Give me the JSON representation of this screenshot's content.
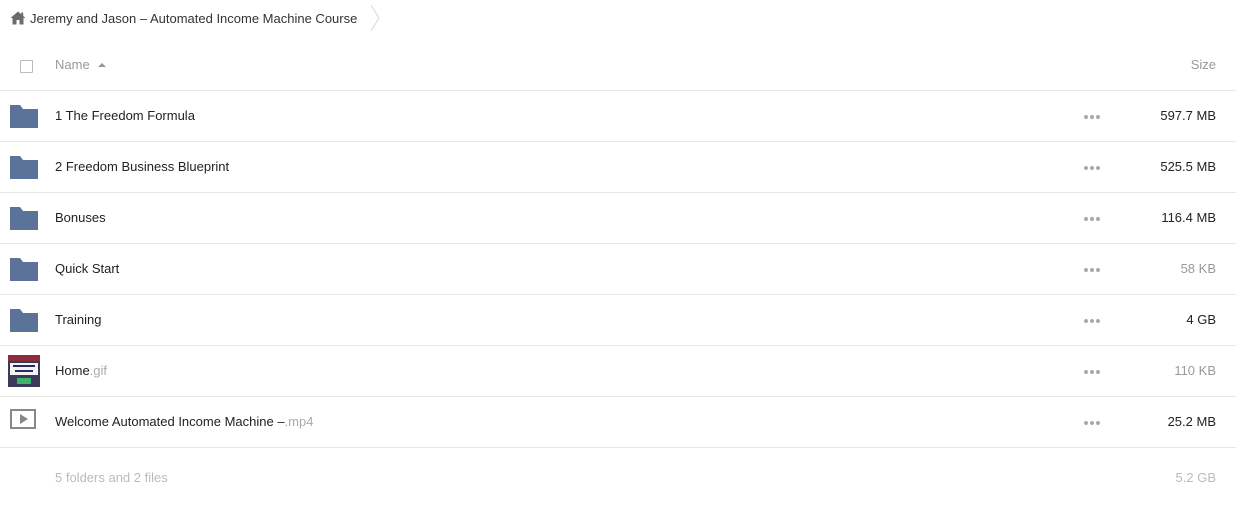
{
  "breadcrumb": {
    "home_icon": "home-icon",
    "title": "Jeremy and Jason – Automated Income Machine Course"
  },
  "header": {
    "name_label": "Name",
    "size_label": "Size",
    "sort_icon": "sort-ascending-icon"
  },
  "colors": {
    "folder": "#5b7399",
    "border": "#e8e8e8",
    "muted_text": "#999999"
  },
  "items": [
    {
      "type": "folder",
      "icon": "folder-icon",
      "name": "1 The Freedom Formula",
      "ext": "",
      "size": "597.7 MB",
      "size_dim": false
    },
    {
      "type": "folder",
      "icon": "folder-icon",
      "name": "2 Freedom Business Blueprint",
      "ext": "",
      "size": "525.5 MB",
      "size_dim": false
    },
    {
      "type": "folder",
      "icon": "folder-icon",
      "name": "Bonuses",
      "ext": "",
      "size": "116.4 MB",
      "size_dim": false
    },
    {
      "type": "folder",
      "icon": "folder-icon",
      "name": "Quick Start",
      "ext": "",
      "size": "58 KB",
      "size_dim": true
    },
    {
      "type": "folder",
      "icon": "folder-icon",
      "name": "Training",
      "ext": "",
      "size": "4 GB",
      "size_dim": false
    },
    {
      "type": "image",
      "icon": "image-thumbnail-icon",
      "name": "Home",
      "ext": ".gif",
      "size": "110 KB",
      "size_dim": true
    },
    {
      "type": "video",
      "icon": "video-file-icon",
      "name": "Welcome Automated Income Machine –",
      "ext": ".mp4",
      "size": "25.2 MB",
      "size_dim": false
    }
  ],
  "footer": {
    "summary": "5 folders and 2 files",
    "total": "5.2 GB"
  }
}
